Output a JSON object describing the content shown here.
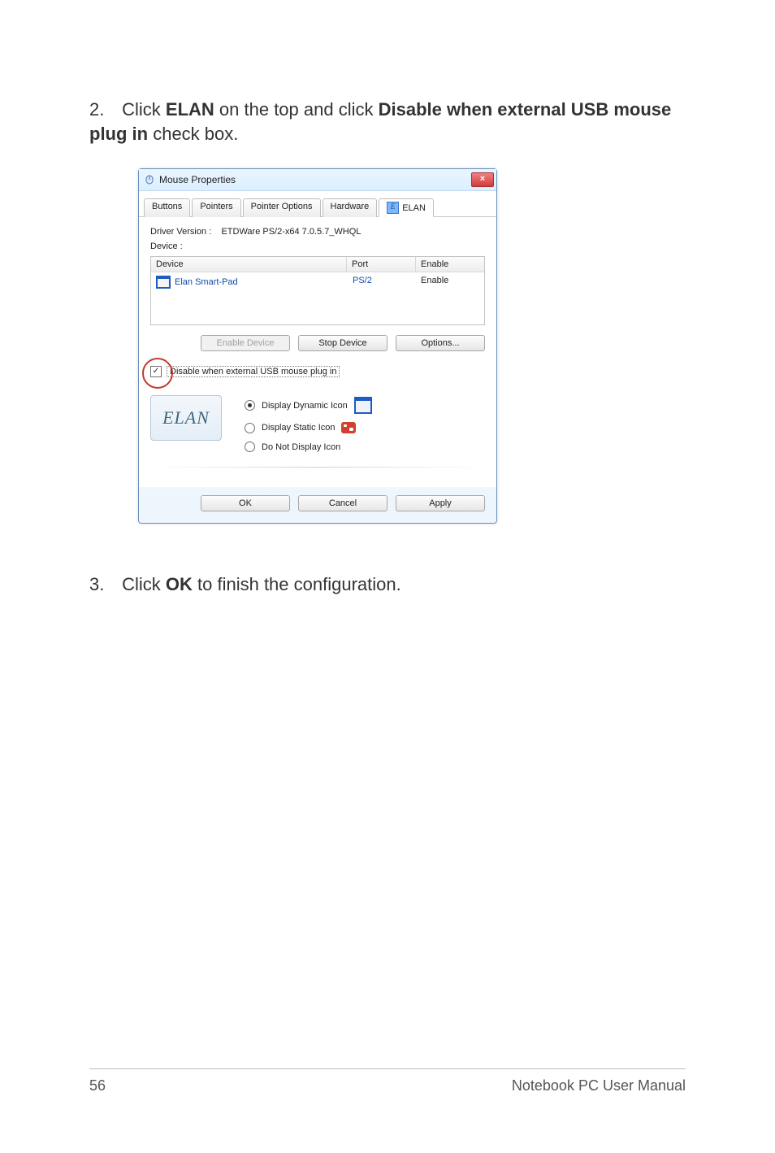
{
  "step2": {
    "num": "2.",
    "prefix": "Click ",
    "bold1": "ELAN",
    "mid": " on the top and click ",
    "bold2": "Disable when external USB mouse plug in",
    "suffix": " check box."
  },
  "step3": {
    "num": "3.",
    "prefix": "Click ",
    "bold1": "OK",
    "suffix": " to finish the configuration."
  },
  "dialog": {
    "title": "Mouse Properties",
    "close_glyph": "×",
    "tabs": {
      "buttons": "Buttons",
      "pointers": "Pointers",
      "pointer_options": "Pointer Options",
      "hardware": "Hardware",
      "elan_glyph": "E",
      "elan": "ELAN"
    },
    "driver_version_label": "Driver Version :",
    "driver_version_value": "ETDWare PS/2-x64 7.0.5.7_WHQL",
    "device_label": "Device :",
    "headers": {
      "device": "Device",
      "port": "Port",
      "enable": "Enable"
    },
    "row": {
      "name": "Elan Smart-Pad",
      "port": "PS/2",
      "enable": "Enable"
    },
    "buttons_mid": {
      "enable_device": "Enable Device",
      "stop_device": "Stop Device",
      "options": "Options..."
    },
    "checkbox_glyph": "✓",
    "checkbox_label": "Disable when external USB mouse plug in",
    "brand": "ELAN",
    "radios": {
      "dynamic": "Display Dynamic Icon",
      "static": "Display Static Icon",
      "none": "Do Not Display Icon"
    },
    "footer": {
      "ok": "OK",
      "cancel": "Cancel",
      "apply": "Apply"
    }
  },
  "page_footer": {
    "page_number": "56",
    "manual": "Notebook PC User Manual"
  }
}
